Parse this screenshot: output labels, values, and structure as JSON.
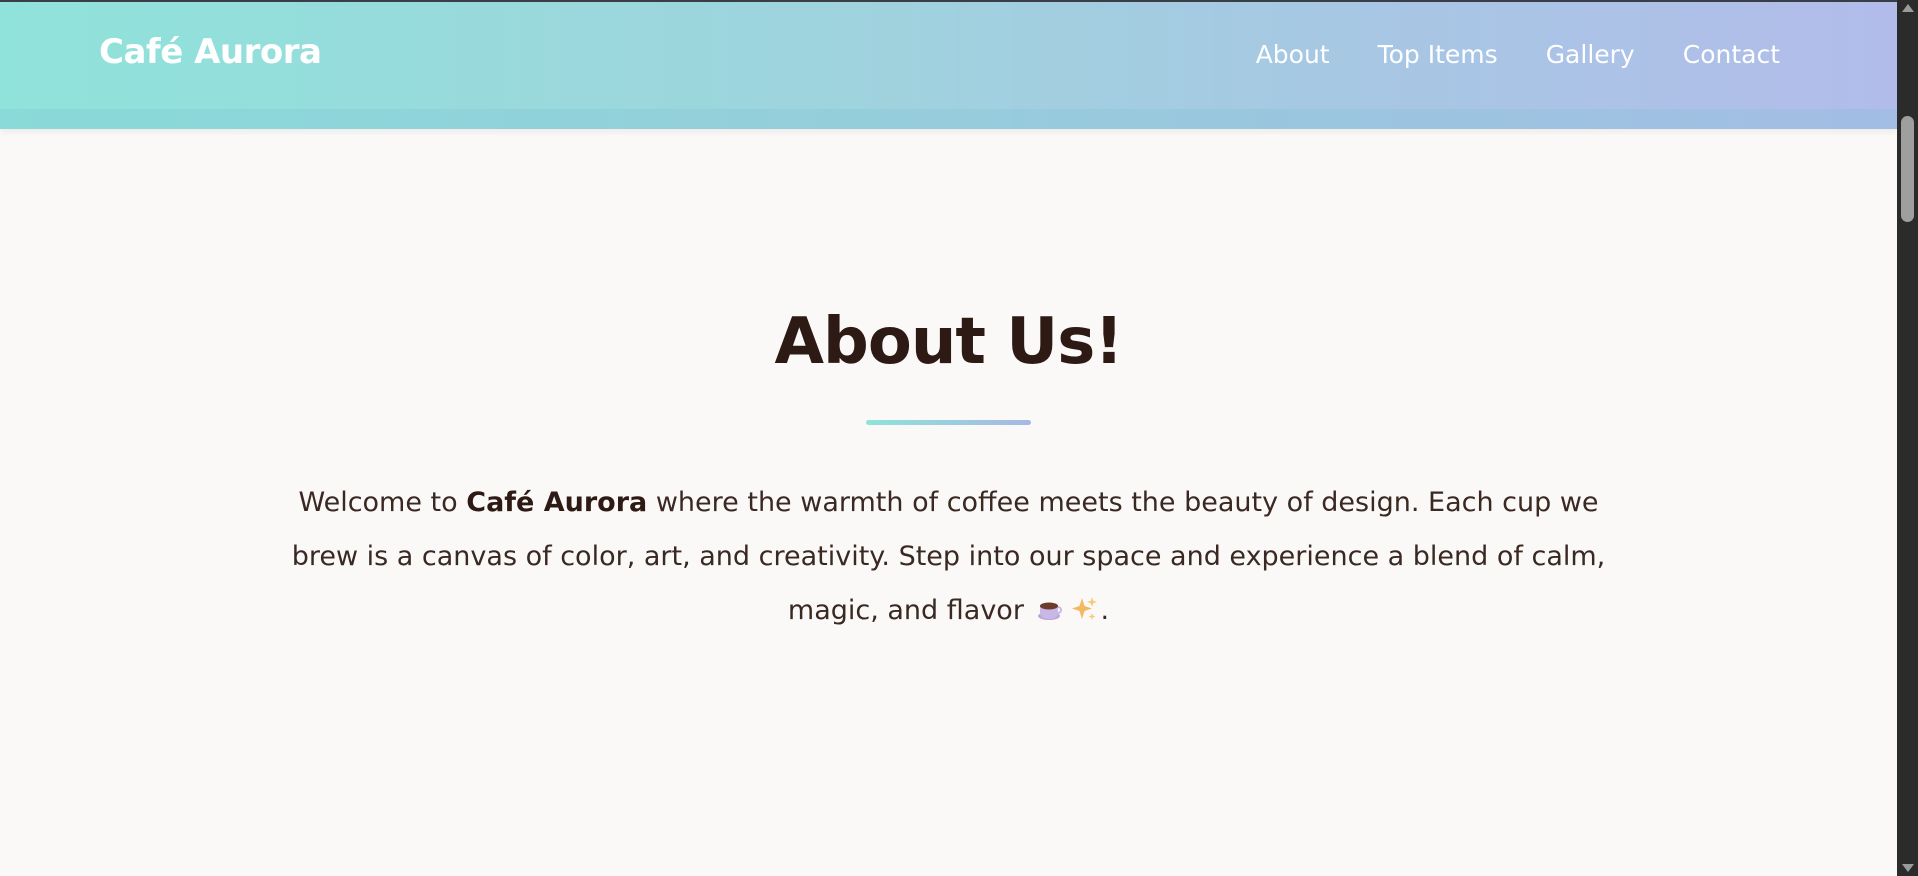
{
  "header": {
    "brand": "Café Aurora",
    "nav": [
      {
        "label": "About"
      },
      {
        "label": "Top Items"
      },
      {
        "label": "Gallery"
      },
      {
        "label": "Contact"
      }
    ]
  },
  "about": {
    "title": "About Us!",
    "text_before": "Welcome to ",
    "brand_bold": "Café Aurora",
    "text_after": " where the warmth of coffee meets the beauty of design. Each cup we brew is a canvas of color, art, and creativity. Step into our space and experience a blend of calm, magic, and flavor",
    "text_end": "."
  },
  "icons": {
    "cup": "hot-beverage-icon",
    "sparkles": "sparkles-icon"
  },
  "colors": {
    "gradient_start": "#8fe3da",
    "gradient_end": "#b2bcea",
    "heading": "#2e1a14",
    "body_text": "#3a2922",
    "page_bg": "#fbf9f7"
  }
}
